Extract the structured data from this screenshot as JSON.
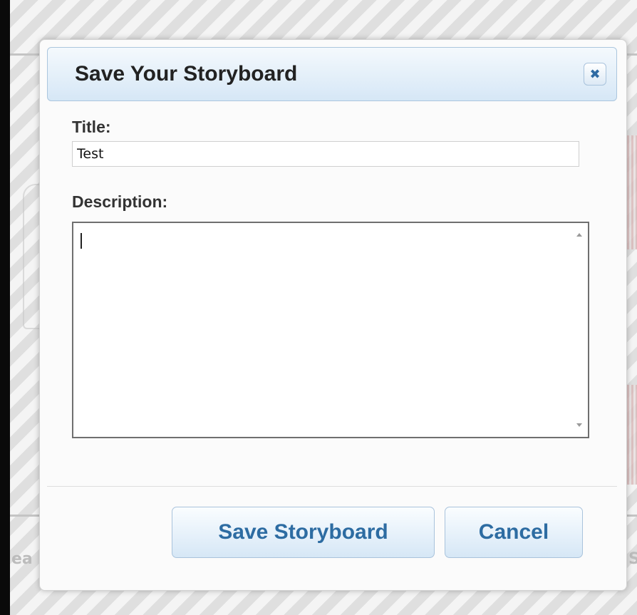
{
  "dialog": {
    "title": "Save Your Storyboard",
    "close_icon": "close-icon",
    "close_glyph": "✖"
  },
  "form": {
    "title_label": "Title:",
    "title_value": "Test",
    "description_label": "Description:",
    "description_value": ""
  },
  "buttons": {
    "save_label": "Save Storyboard",
    "cancel_label": "Cancel"
  },
  "background": {
    "left_text": "ea",
    "right_text": "S"
  },
  "colors": {
    "accent": "#2d6ca2",
    "titlebar_top": "#f4f9fd",
    "titlebar_bottom": "#d6e7f6"
  }
}
